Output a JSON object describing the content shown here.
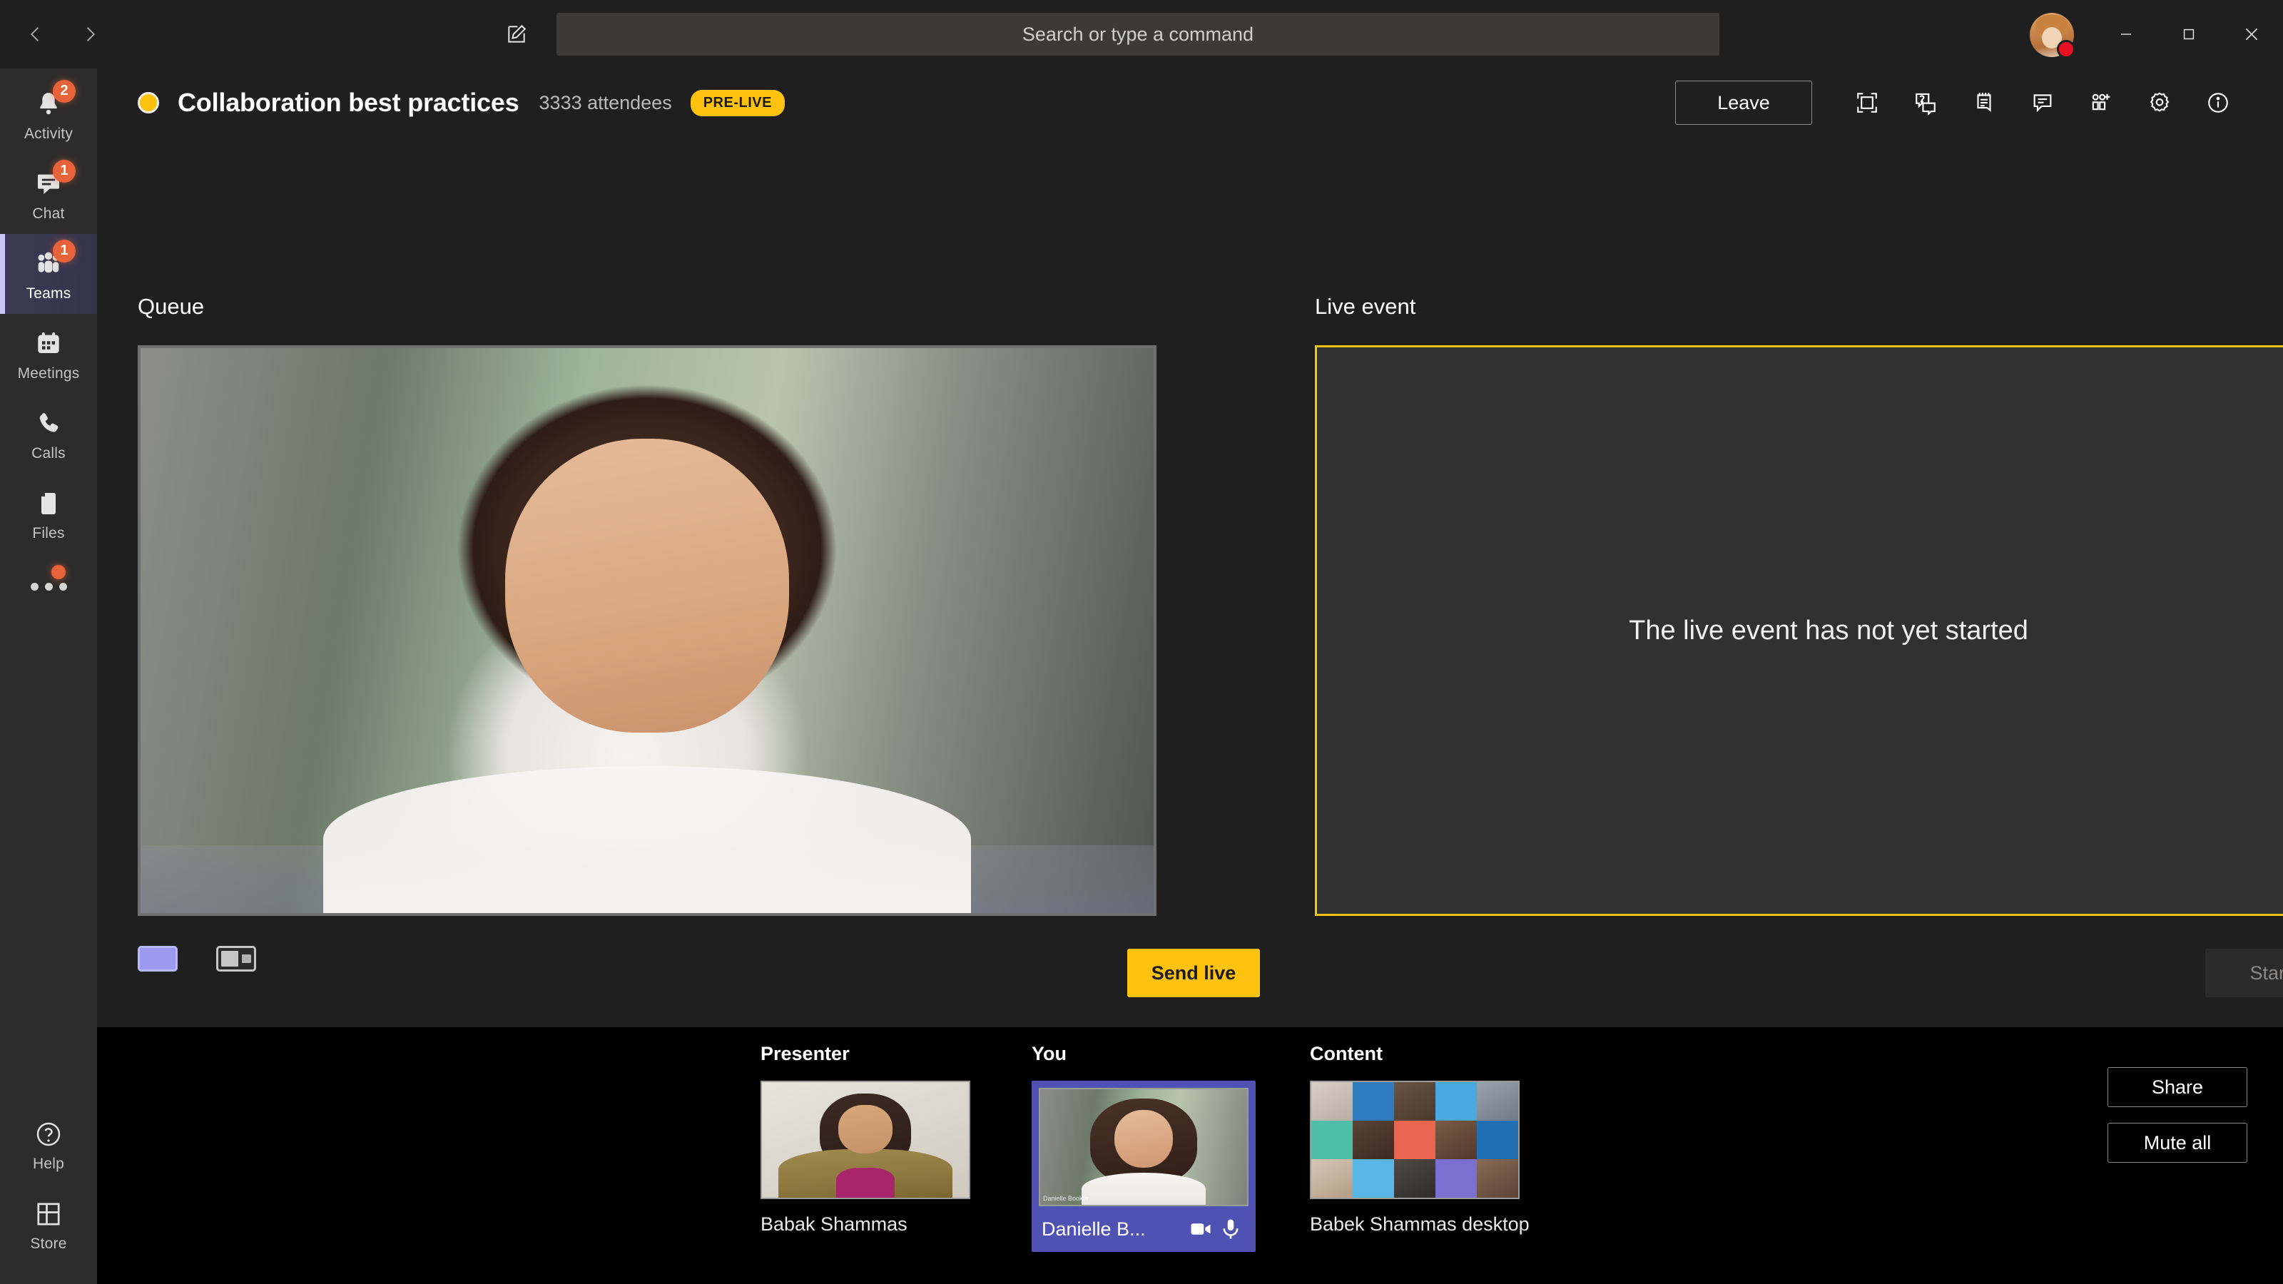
{
  "titlebar": {
    "back_icon": "chevron-left-icon",
    "forward_icon": "chevron-right-icon",
    "compose_icon": "compose-pencil-icon",
    "search_placeholder": "Search or type a command",
    "avatar_label": "Danielle Booker",
    "presence": "busy",
    "presence_color": "#e81123",
    "minimize_label": "—",
    "maximize_label": "□",
    "close_label": "✕"
  },
  "rail": {
    "items": [
      {
        "label": "Activity",
        "icon": "bell-icon",
        "badge": "2",
        "active": false
      },
      {
        "label": "Chat",
        "icon": "chat-icon",
        "badge": "1",
        "active": false
      },
      {
        "label": "Teams",
        "icon": "people-icon",
        "badge": "1",
        "active": true
      },
      {
        "label": "Meetings",
        "icon": "calendar-icon",
        "badge": "",
        "active": false
      },
      {
        "label": "Calls",
        "icon": "phone-icon",
        "badge": "",
        "active": false
      },
      {
        "label": "Files",
        "icon": "file-icon",
        "badge": "",
        "active": false
      }
    ],
    "more_icon": "more-dots-icon",
    "more_has_badge": true,
    "bottom": [
      {
        "label": "Help",
        "icon": "help-circle-icon"
      },
      {
        "label": "Store",
        "icon": "store-grid-icon"
      }
    ]
  },
  "meeting": {
    "status_dot_color": "#ffc20e",
    "title": "Collaboration best practices",
    "attendees": "3333 attendees",
    "status_badge": "PRE-LIVE",
    "leave_label": "Leave",
    "toolbar_icons": [
      {
        "name": "fullscreen-icon"
      },
      {
        "name": "qna-icon"
      },
      {
        "name": "meeting-notes-icon"
      },
      {
        "name": "chat-bubble-icon"
      },
      {
        "name": "add-people-icon"
      },
      {
        "name": "settings-gear-icon"
      },
      {
        "name": "info-icon"
      }
    ]
  },
  "stage": {
    "queue_label": "Queue",
    "live_label": "Live event",
    "live_message": "The live event has not yet started",
    "live_border_color": "#ffc20e",
    "send_live_label": "Send live",
    "send_live_color": "#ffc20e",
    "start_label": "Start",
    "start_disabled": true,
    "layouts": [
      {
        "name": "layout-single",
        "selected": true
      },
      {
        "name": "layout-side-by-side",
        "selected": false
      }
    ]
  },
  "tray": {
    "groups": [
      {
        "title": "Presenter",
        "name": "Babak Shammas",
        "selected": false
      },
      {
        "title": "You",
        "name": "Danielle B...",
        "selected": true,
        "video_icon": "camera-icon",
        "mic_icon": "microphone-icon",
        "overlay_name": "Danielle Booker"
      },
      {
        "title": "Content",
        "name": "Babek Shammas desktop",
        "selected": false
      }
    ],
    "buttons": [
      {
        "label": "Share",
        "name": "share-button"
      },
      {
        "label": "Mute all",
        "name": "mute-all-button"
      }
    ],
    "selection_color": "#4f52b2"
  }
}
